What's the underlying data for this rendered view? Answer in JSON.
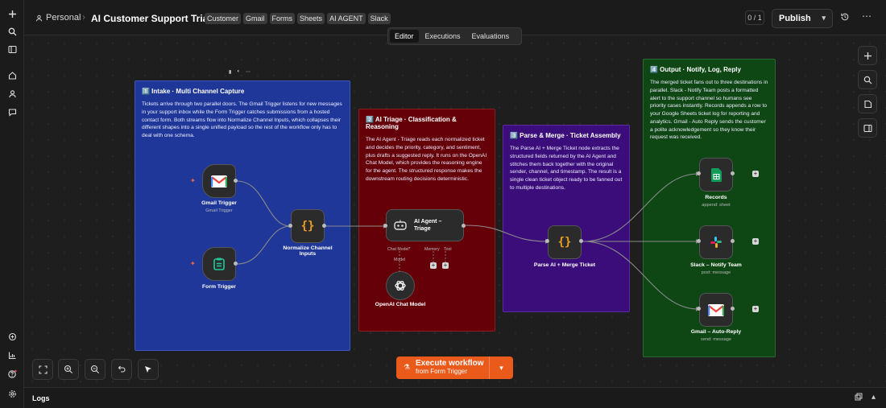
{
  "header": {
    "owner": "Personal",
    "separator": "›",
    "title": "AI Customer Support Triage",
    "tags": [
      "Customer",
      "Gmail",
      "Forms",
      "Sheets",
      "AI AGENT",
      "Slack"
    ],
    "pager": "0 / 1",
    "publish_label": "Publish"
  },
  "tabs": [
    {
      "label": "Editor",
      "active": true
    },
    {
      "label": "Executions",
      "active": false
    },
    {
      "label": "Evaluations",
      "active": false
    }
  ],
  "stickies": {
    "intake": {
      "title": "1️⃣ Intake · Multi Channel Capture",
      "body": "Tickets arrive through two parallel doors. The Gmail Trigger listens for new messages in your support inbox while the Form Trigger catches submissions from a hosted contact form. Both streams flow into Normalize Channel Inputs, which collapses their different shapes into a single unified payload so the rest of the workflow only has to deal with one schema."
    },
    "triage": {
      "title": "2️⃣ AI Triage · Classification & Reasoning",
      "body": "The AI Agent - Triage reads each normalized ticket and decides the priority, category, and sentiment, plus drafts a suggested reply. It runs on the OpenAI Chat Model, which provides the reasoning engine for the agent. The structured response makes the downstream routing decisions deterministic."
    },
    "parse": {
      "title": "3️⃣ Parse & Merge · Ticket Assembly",
      "body": "The Parse AI + Merge Ticket node extracts the structured fields returned by the AI Agent and stitches them back together with the original sender, channel, and timestamp. The result is a single clean ticket object ready to be fanned out to multiple destinations."
    },
    "output": {
      "title": "4️⃣ Output · Notify, Log, Reply",
      "body": "The merged ticket fans out to three destinations in parallel. Slack - Notify Team posts a formatted alert to the support channel so humans see priority cases instantly. Records appends a row to your Google Sheets ticket log for reporting and analytics. Gmail - Auto Reply sends the customer a polite acknowledgement so they know their request was received."
    }
  },
  "nodes": {
    "gmail_trigger": {
      "label": "Gmail Trigger",
      "sub": "Gmail Trigger"
    },
    "form_trigger": {
      "label": "Form Trigger"
    },
    "normalize": {
      "label": "Normalize Channel Inputs"
    },
    "agent": {
      "label": "AI Agent – Triage",
      "port_chat": "Chat Model*",
      "port_memory": "Memory",
      "port_tool": "Tool",
      "model_label": "Model"
    },
    "openai": {
      "label": "OpenAI Chat Model"
    },
    "parse": {
      "label": "Parse AI + Merge Ticket"
    },
    "records": {
      "label": "Records",
      "sub": "append: sheet"
    },
    "slack": {
      "label": "Slack – Notify Team",
      "sub": "post: message"
    },
    "gmail_reply": {
      "label": "Gmail – Auto-Reply",
      "sub": "send: message"
    }
  },
  "execute": {
    "label": "Execute workflow",
    "sub": "from Form Trigger"
  },
  "logs": {
    "label": "Logs"
  },
  "colors": {
    "accent": "#ea5a1a",
    "intake": "#1f3799",
    "triage": "#650008",
    "parse": "#3a0d7a",
    "output": "#0e4614"
  }
}
